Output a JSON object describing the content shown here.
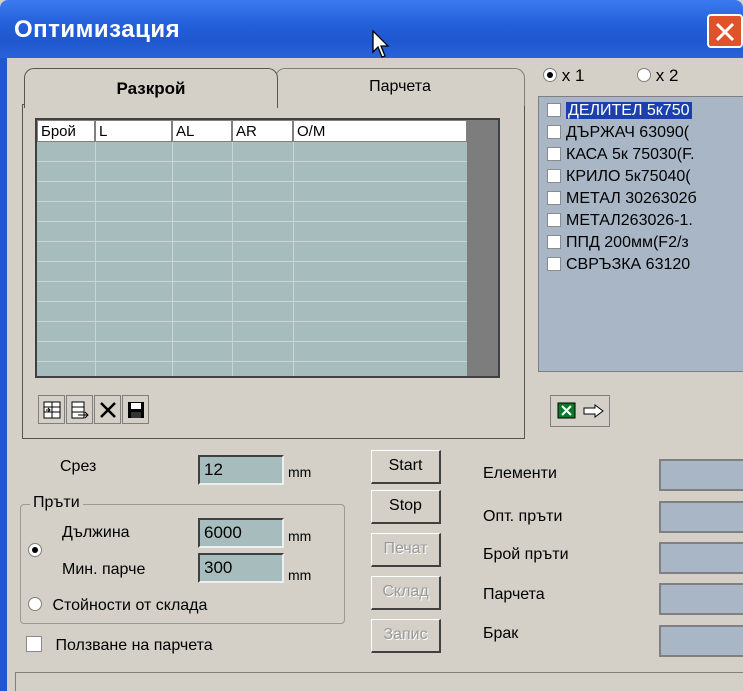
{
  "window": {
    "title": "Оптимизация"
  },
  "tabs": [
    {
      "label": "Разкрой",
      "active": true
    },
    {
      "label": "Парчета",
      "active": false
    }
  ],
  "grid": {
    "columns": [
      "Брой",
      "L",
      "AL",
      "AR",
      "O/M"
    ],
    "rows": []
  },
  "grid_toolbar": {
    "icons": [
      "insert-row-icon",
      "append-row-icon",
      "delete-icon",
      "save-icon"
    ]
  },
  "multiplier": {
    "options": [
      {
        "label": "x 1",
        "selected": true
      },
      {
        "label": "x 2",
        "selected": false
      }
    ]
  },
  "profiles": [
    {
      "label": "ДЕЛИТЕЛ 5к750",
      "checked": false,
      "selected": true
    },
    {
      "label": "ДЪРЖАЧ 63090(",
      "checked": false,
      "selected": false
    },
    {
      "label": "КАСА 5к 75030(F.",
      "checked": false,
      "selected": false
    },
    {
      "label": "КРИЛО 5к75040(",
      "checked": false,
      "selected": false
    },
    {
      "label": "МЕТАЛ 3026302б",
      "checked": false,
      "selected": false
    },
    {
      "label": "МЕТАЛ263026-1.",
      "checked": false,
      "selected": false
    },
    {
      "label": "ППД 200мм(F2/з",
      "checked": false,
      "selected": false
    },
    {
      "label": "СВРЪЗКА 63120",
      "checked": false,
      "selected": false
    }
  ],
  "form": {
    "cut_label": "Срез",
    "cut_value": "12",
    "unit": "mm",
    "group_label": "Пръти",
    "length_label": "Дължина",
    "length_value": "6000",
    "min_piece_label": "Мин. парче",
    "min_piece_value": "300",
    "source_option_length": true,
    "stock_values_label": "Стойности от склада",
    "use_pieces_label": "Ползване на парчета",
    "use_pieces_checked": false
  },
  "buttons": {
    "start": "Start",
    "stop": "Stop",
    "print": "Печат",
    "stock": "Склад",
    "save": "Запис"
  },
  "stats": {
    "elements_label": "Елементи",
    "opt_bars_label": "Опт. пръти",
    "bar_count_label": "Брой пръти",
    "pieces_label": "Парчета",
    "waste_label": "Брак",
    "elements_value": "",
    "opt_bars_value": "",
    "bar_count_value": "",
    "pieces_value": "",
    "waste_value": ""
  },
  "colors": {
    "title_bar": "#2461da",
    "close_button": "#e0532a",
    "grid_background": "#a7bdbd",
    "list_background": "#a9b6c6",
    "selection": "#1c3fae"
  }
}
